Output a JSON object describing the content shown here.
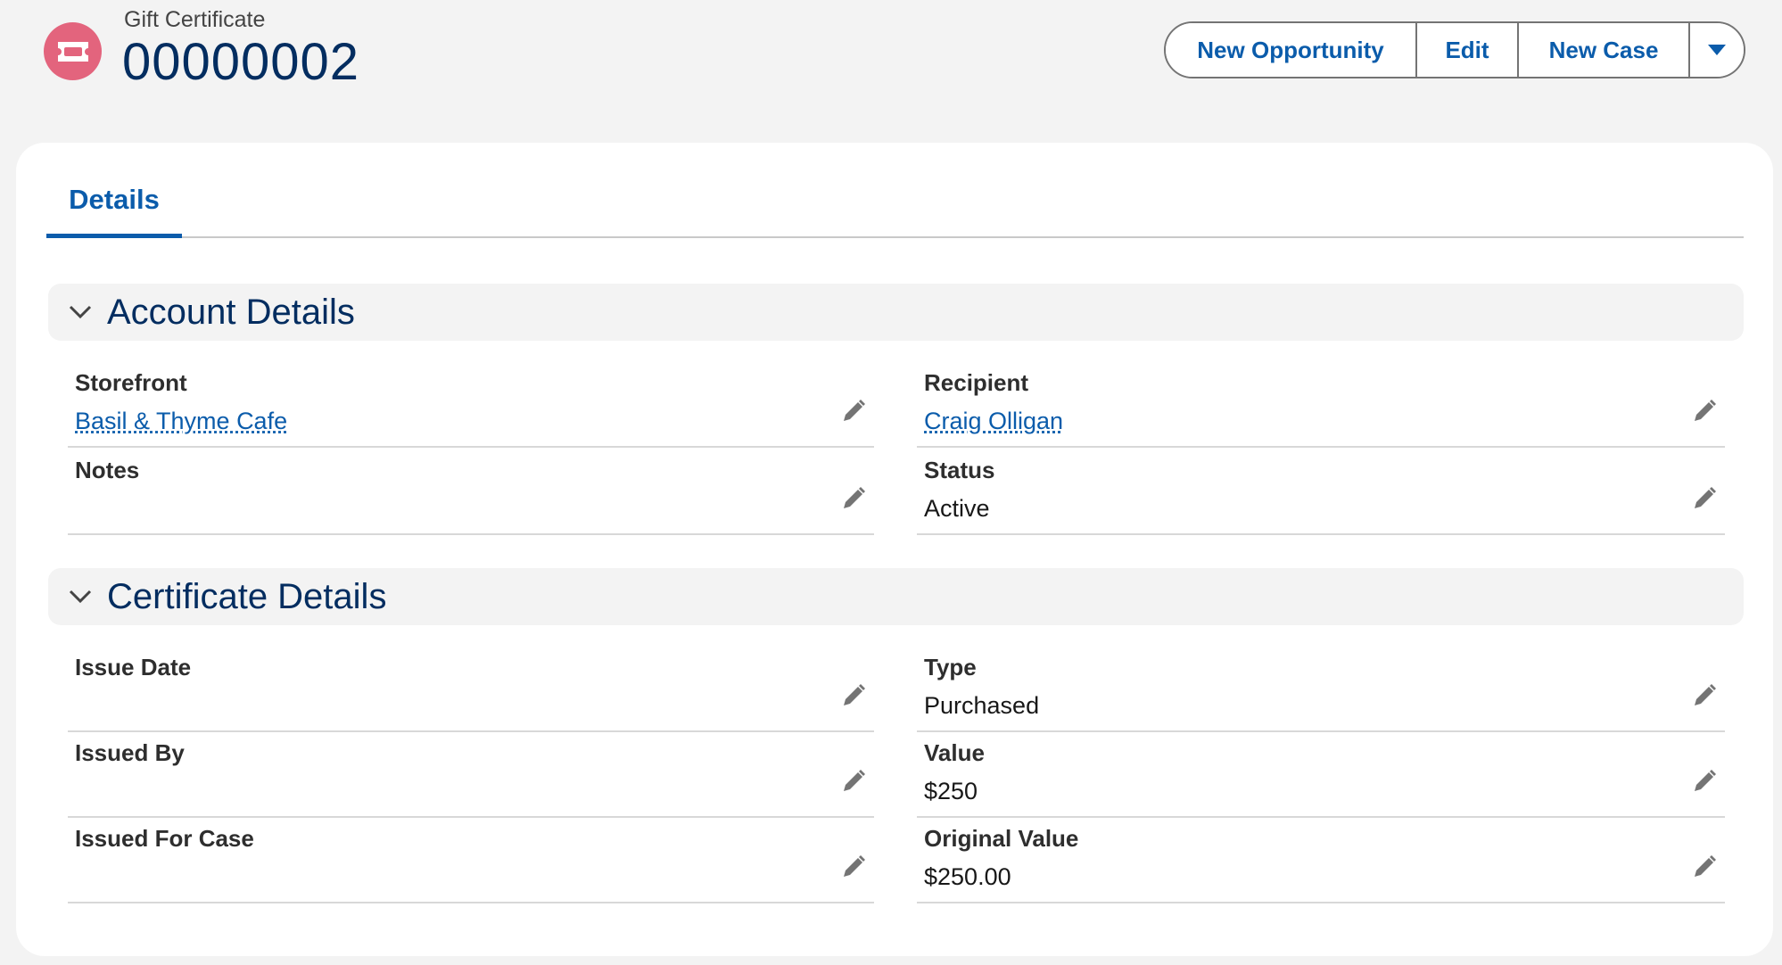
{
  "header": {
    "object_type": "Gift Certificate",
    "record_name": "00000002",
    "icon": "ticket-icon",
    "buttons": {
      "new_opportunity": "New Opportunity",
      "edit": "Edit",
      "new_case": "New Case",
      "more_icon": "chevron-down-icon"
    }
  },
  "tabs": [
    {
      "label": "Details",
      "active": true
    }
  ],
  "sections": {
    "account": {
      "title": "Account Details",
      "fields": {
        "storefront": {
          "label": "Storefront",
          "value": "Basil & Thyme Cafe",
          "is_link": true
        },
        "recipient": {
          "label": "Recipient",
          "value": "Craig Olligan",
          "is_link": true
        },
        "notes": {
          "label": "Notes",
          "value": ""
        },
        "status": {
          "label": "Status",
          "value": "Active"
        }
      }
    },
    "certificate": {
      "title": "Certificate Details",
      "fields": {
        "issue_date": {
          "label": "Issue Date",
          "value": ""
        },
        "type": {
          "label": "Type",
          "value": "Purchased"
        },
        "issued_by": {
          "label": "Issued By",
          "value": ""
        },
        "value": {
          "label": "Value",
          "value": "$250"
        },
        "issued_for_case": {
          "label": "Issued For Case",
          "value": ""
        },
        "original_value": {
          "label": "Original Value",
          "value": "$250.00"
        }
      }
    }
  },
  "colors": {
    "brand_blue": "#0b5cab",
    "title_navy": "#032d60",
    "icon_pink": "#e3647d",
    "page_bg": "#f3f3f3"
  }
}
